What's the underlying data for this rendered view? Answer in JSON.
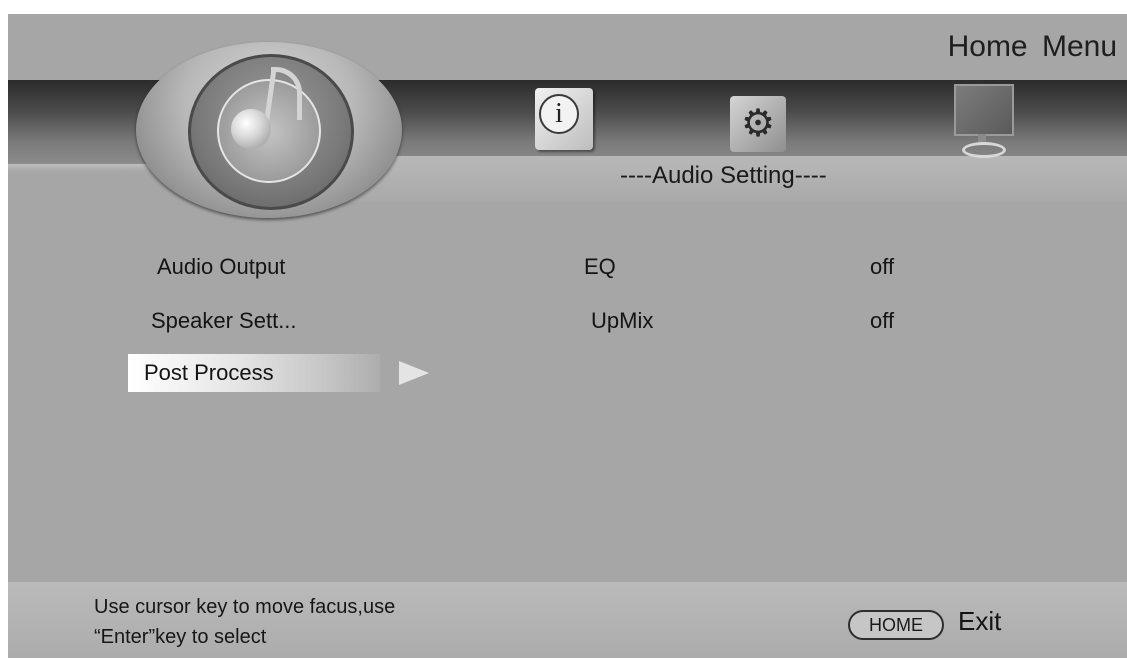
{
  "header": {
    "menu_title": "Home  Menu",
    "subtitle": "----Audio Setting----"
  },
  "tabs": [
    {
      "icon": "info-icon",
      "glyph": "i"
    },
    {
      "icon": "gear-icon",
      "glyph": "⚙"
    },
    {
      "icon": "monitor-icon"
    }
  ],
  "logo": {
    "icon": "disc-music-note-icon"
  },
  "left_menu": [
    {
      "label": "Audio Output"
    },
    {
      "label": "Speaker Sett..."
    },
    {
      "label": "Post  Process",
      "selected": true
    }
  ],
  "options": [
    {
      "label": "EQ",
      "value": "off"
    },
    {
      "label": "UpMix",
      "value": "off"
    }
  ],
  "footer": {
    "hint_line1": "Use cursor key to move facus,use",
    "hint_line2": "“Enter”key to select",
    "home_key": "HOME",
    "exit_label": "Exit"
  }
}
